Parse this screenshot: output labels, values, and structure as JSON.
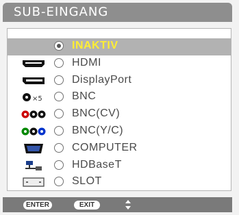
{
  "title": "SUB-EINGANG",
  "items": [
    {
      "label": "INAKTIV",
      "icon": "none",
      "selected": true
    },
    {
      "label": "HDMI",
      "icon": "hdmi-port-icon"
    },
    {
      "label": "DisplayPort",
      "icon": "displayport-icon"
    },
    {
      "label": "BNC",
      "icon": "bnc-connector-icon",
      "icon_text": "×5"
    },
    {
      "label": "BNC(CV)",
      "icon": "bnc-cv-connector-icon"
    },
    {
      "label": "BNC(Y/C)",
      "icon": "bnc-yc-connector-icon"
    },
    {
      "label": "COMPUTER",
      "icon": "vga-port-icon"
    },
    {
      "label": "HDBaseT",
      "icon": "network-icon"
    },
    {
      "label": "SLOT",
      "icon": "slot-card-icon"
    }
  ],
  "footer": {
    "enter": "ENTER",
    "exit": "EXIT"
  },
  "colors": {
    "titlebar": "#8e8e8e",
    "selected_row": "#b2b2b2",
    "selected_text": "#ffee33",
    "footer": "#7a7a7a"
  }
}
